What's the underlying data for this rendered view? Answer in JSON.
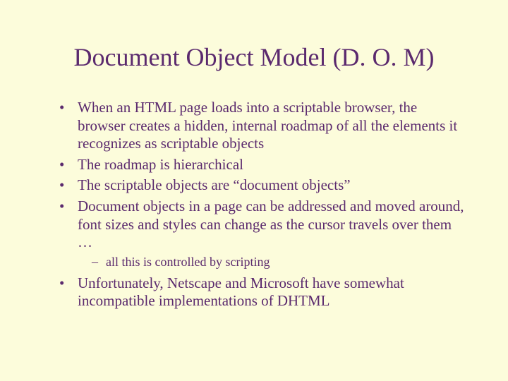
{
  "title": "Document Object Model (D. O. M)",
  "bullets": [
    "When an HTML page loads into a scriptable browser, the browser creates a hidden, internal roadmap of all the elements it recognizes as scriptable objects",
    "The roadmap is hierarchical",
    "The scriptable objects are “document objects”",
    "Document objects in a page can be addressed and moved around, font sizes and styles can change as the cursor travels over them …",
    "Unfortunately, Netscape and Microsoft have somewhat incompatible implementations of DHTML"
  ],
  "sub_after_index": 3,
  "sub_bullets": [
    "all this is controlled by scripting"
  ]
}
